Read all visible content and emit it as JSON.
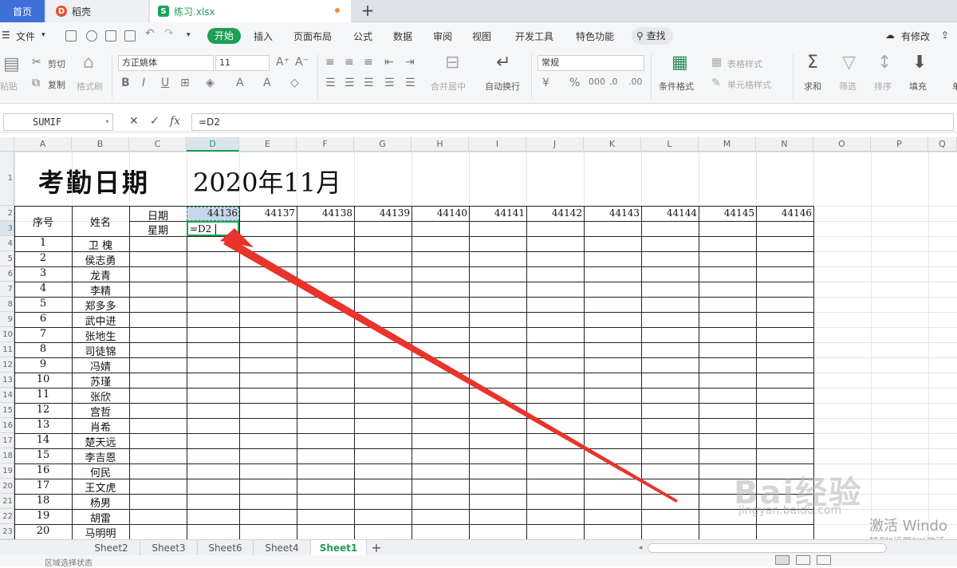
{
  "tabs": {
    "home": "首页",
    "daoke": "稻壳",
    "file": "练习.xlsx",
    "new_tab": "+"
  },
  "menu": {
    "file": "文件",
    "start": "开始",
    "items": [
      "插入",
      "页面布局",
      "公式",
      "数据",
      "审阅",
      "视图",
      "开发工具",
      "特色功能"
    ],
    "search": "查找",
    "has_changes": "有修改"
  },
  "ribbon": {
    "paste": "粘贴",
    "cut": "剪切",
    "copy": "复制",
    "format_painter": "格式刷",
    "font_name": "方正姚体",
    "font_size": "11",
    "merge_center": "合并居中",
    "wrap_text": "自动换行",
    "number_format": "常规",
    "conditional_format": "条件格式",
    "table_style": "表格样式",
    "cell_style": "单元格样式",
    "sum": "求和",
    "filter": "筛选",
    "sort": "排序",
    "fill": "填充",
    "single": "单"
  },
  "formula_bar": {
    "name_box": "SUMIF",
    "cancel": "✕",
    "confirm": "✓",
    "fx": "fx",
    "formula": "=D2"
  },
  "columns": [
    "A",
    "B",
    "C",
    "D",
    "E",
    "F",
    "G",
    "H",
    "I",
    "J",
    "K",
    "L",
    "M",
    "N",
    "O",
    "P",
    "Q"
  ],
  "rows": [
    "1",
    "2",
    "3",
    "4",
    "5",
    "6",
    "7",
    "8",
    "9",
    "10",
    "11",
    "12",
    "13",
    "14",
    "15",
    "16",
    "17",
    "18",
    "19",
    "20",
    "21",
    "22",
    "23"
  ],
  "sheet": {
    "title": "考勤日期",
    "month": "2020年11月",
    "header_seq": "序号",
    "header_name": "姓名",
    "label_date": "日期",
    "label_weekday": "星期",
    "date_values": [
      "44136",
      "44137",
      "44138",
      "44139",
      "44140",
      "44141",
      "44142",
      "44143",
      "44144",
      "44145",
      "44146"
    ],
    "editing_cell": "=D2",
    "employees": [
      {
        "seq": "1",
        "name": "卫 槐"
      },
      {
        "seq": "2",
        "name": "侯志勇"
      },
      {
        "seq": "3",
        "name": "龙青"
      },
      {
        "seq": "4",
        "name": "李精"
      },
      {
        "seq": "5",
        "name": "郑多多"
      },
      {
        "seq": "6",
        "name": "武中进"
      },
      {
        "seq": "7",
        "name": "张地生"
      },
      {
        "seq": "8",
        "name": "司徒锦"
      },
      {
        "seq": "9",
        "name": "冯婧"
      },
      {
        "seq": "10",
        "name": "苏瑾"
      },
      {
        "seq": "11",
        "name": "张欣"
      },
      {
        "seq": "12",
        "name": "宫哲"
      },
      {
        "seq": "13",
        "name": "肖希"
      },
      {
        "seq": "14",
        "name": "楚天远"
      },
      {
        "seq": "15",
        "name": "李吉恩"
      },
      {
        "seq": "16",
        "name": "何民"
      },
      {
        "seq": "17",
        "name": "王文虎"
      },
      {
        "seq": "18",
        "name": "杨男"
      },
      {
        "seq": "19",
        "name": "胡雷"
      },
      {
        "seq": "20",
        "name": "马明明"
      }
    ]
  },
  "sheet_tabs": [
    "Sheet2",
    "Sheet3",
    "Sheet6",
    "Sheet4",
    "Sheet1"
  ],
  "active_sheet": "Sheet1",
  "add_sheet": "+",
  "status": "区域选择状态",
  "watermark": {
    "brand": "Bai经验",
    "url": "jingyan.baidu.com"
  },
  "activation": {
    "line1": "激活 Windo",
    "line2": "转到\"设置\"以激活"
  },
  "colors": {
    "accent_green": "#1e9e57",
    "home_tab_blue": "#3f6fd8",
    "arrow_red": "#e8342b",
    "selection_fill": "#c8d6ec"
  }
}
